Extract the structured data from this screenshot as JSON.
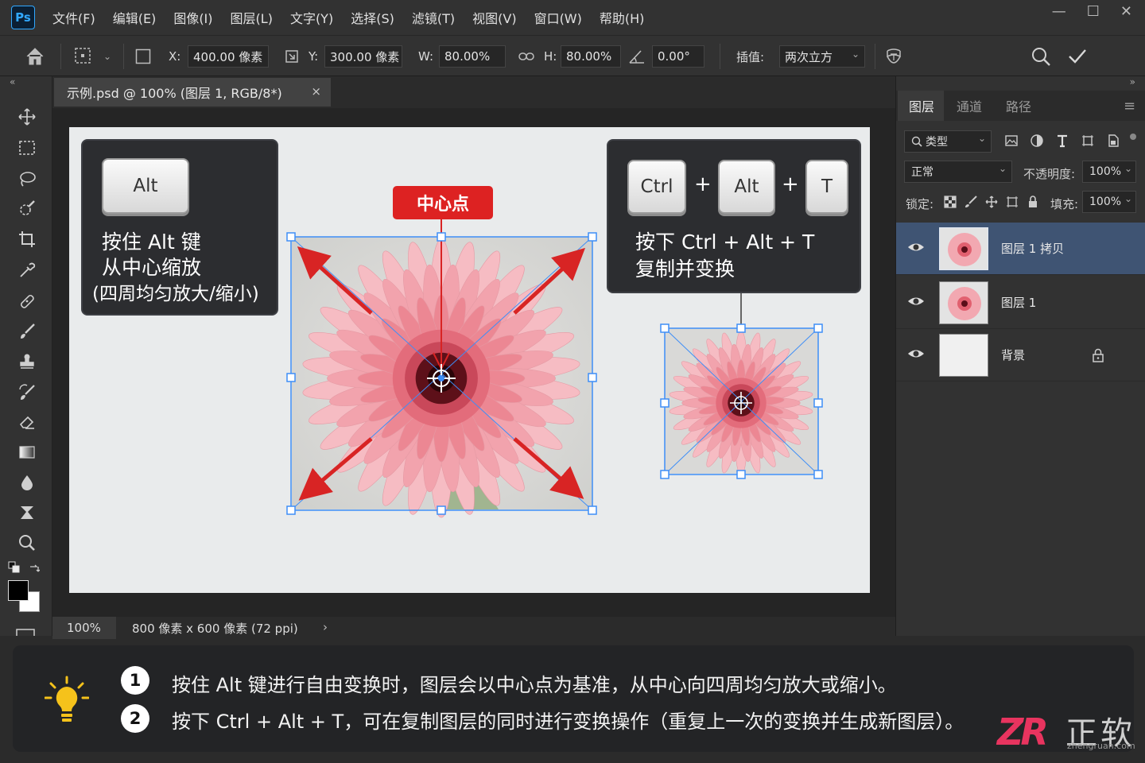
{
  "app": {
    "logo": "Ps",
    "menus": [
      "文件(F)",
      "编辑(E)",
      "图像(I)",
      "图层(L)",
      "文字(Y)",
      "选择(S)",
      "滤镜(T)",
      "视图(V)",
      "窗口(W)",
      "帮助(H)"
    ],
    "window_controls": [
      "—",
      "☐",
      "✕"
    ]
  },
  "options_bar": {
    "x_label": "X:",
    "x_value": "400.00 像素",
    "y_label": "Y:",
    "y_value": "300.00 像素",
    "w_label": "W:",
    "w_value": "80.00%",
    "h_label": "H:",
    "h_value": "80.00%",
    "angle_value": "0.00°",
    "interp_label": "插值:",
    "interp_value": "两次立方"
  },
  "panel_collapse": {
    "left": "«",
    "right": "»"
  },
  "document": {
    "tab_title": "示例.psd @ 100% (图层 1, RGB/8*)",
    "close": "×"
  },
  "canvas": {
    "left_card": {
      "key": "Alt",
      "line1": "按住 Alt 键",
      "line2": "从中心缩放",
      "line3": "(四周均匀放大/缩小)"
    },
    "center_label": "中心点",
    "right_card": {
      "key1": "Ctrl",
      "key2": "Alt",
      "key3": "T",
      "plus": "+",
      "line1": "按下 Ctrl + Alt + T",
      "line2": "复制并变换"
    }
  },
  "status_bar": {
    "zoom": "100%",
    "dimensions": "800 像素 x 600 像素 (72 ppi)",
    "arrow": "›"
  },
  "layers_panel": {
    "tabs": [
      "图层",
      "通道",
      "路径"
    ],
    "filter_value": "类型",
    "blend_mode": "正常",
    "opacity_label": "不透明度:",
    "opacity_value": "100%",
    "lock_label": "锁定:",
    "fill_label": "填充:",
    "fill_value": "100%",
    "layers": [
      {
        "name": "图层 1 拷贝",
        "selected": true
      },
      {
        "name": "图层 1",
        "selected": false
      },
      {
        "name": "背景",
        "selected": false,
        "locked": true
      }
    ]
  },
  "tips": {
    "items": [
      {
        "num": "1",
        "text": "按住 Alt 键进行自由变换时，图层会以中心点为基准，从中心向四周均匀放大或缩小。"
      },
      {
        "num": "2",
        "text": "按下 Ctrl + Alt + T，可在复制图层的同时进行变换操作（重复上一次的变换并生成新图层）。"
      }
    ]
  },
  "watermark": {
    "mark": "ZR",
    "name": "正软",
    "url": "zhengruan.com"
  },
  "colors": {
    "accent_blue": "#3e8ef7",
    "accent_red": "#dd2222",
    "layer_selected": "#3f5473"
  }
}
